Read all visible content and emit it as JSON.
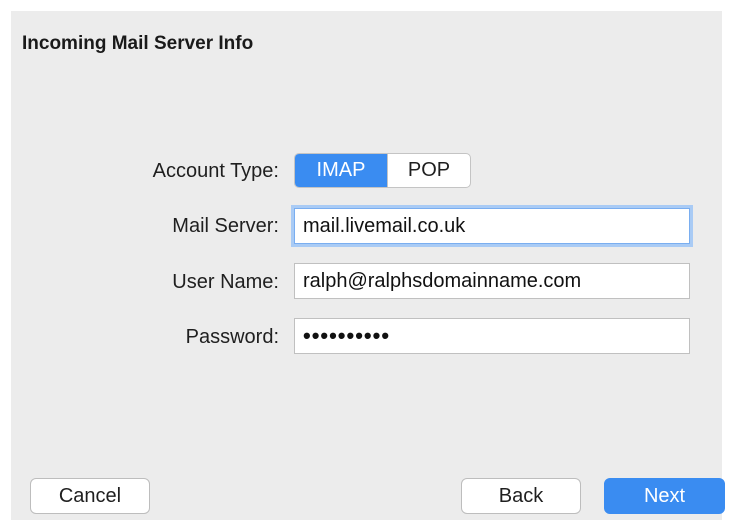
{
  "header": {
    "title": "Incoming Mail Server Info"
  },
  "form": {
    "account_type": {
      "label": "Account Type:",
      "options": [
        "IMAP",
        "POP"
      ],
      "selected": "IMAP"
    },
    "mail_server": {
      "label": "Mail Server:",
      "value": "mail.livemail.co.uk"
    },
    "user_name": {
      "label": "User Name:",
      "value": "ralph@ralphsdomainname.com"
    },
    "password": {
      "label": "Password:",
      "value": "••••••••••"
    }
  },
  "footer": {
    "cancel_label": "Cancel",
    "back_label": "Back",
    "next_label": "Next"
  },
  "colors": {
    "accent": "#3a8cf1",
    "panel_background": "#ececec",
    "focus_ring": "#a9cbf5"
  }
}
